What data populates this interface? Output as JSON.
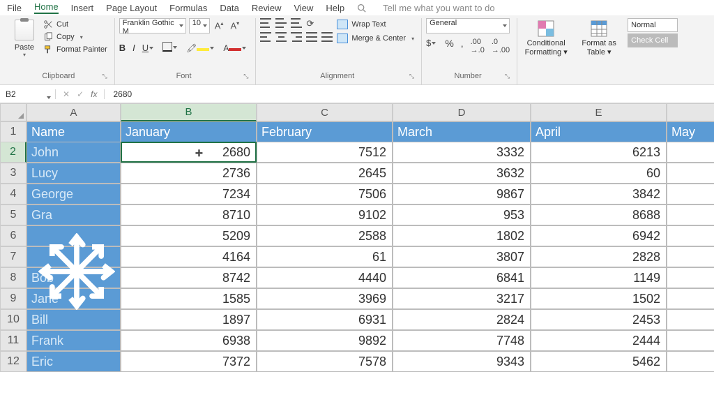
{
  "menu": {
    "file": "File",
    "home": "Home",
    "insert": "Insert",
    "page": "Page Layout",
    "formulas": "Formulas",
    "data": "Data",
    "review": "Review",
    "view": "View",
    "help": "Help",
    "tell": "Tell me what you want to do"
  },
  "ribbon": {
    "paste": "Paste",
    "cut": "Cut",
    "copy": "Copy",
    "fp": "Format Painter",
    "clipboard": "Clipboard",
    "fontname": "Franklin Gothic M",
    "fontsize": "10",
    "font": "Font",
    "wrap": "Wrap Text",
    "merge": "Merge & Center",
    "alignment": "Alignment",
    "numfmt": "General",
    "number": "Number",
    "cond": "Conditional",
    "cond2": "Formatting",
    "fat": "Format as",
    "fat2": "Table",
    "normal": "Normal",
    "check": "Check Cell"
  },
  "formulabar": {
    "cellref": "B2",
    "value": "2680"
  },
  "columns": [
    "A",
    "B",
    "C",
    "D",
    "E"
  ],
  "headers": {
    "name": "Name",
    "jan": "January",
    "feb": "February",
    "mar": "March",
    "apr": "April",
    "may": "May"
  },
  "chart_data": {
    "type": "table",
    "columns": [
      "Name",
      "January",
      "February",
      "March",
      "April"
    ],
    "rows": [
      {
        "name": "John",
        "jan": 2680,
        "feb": 7512,
        "mar": 3332,
        "apr": 6213
      },
      {
        "name": "Lucy",
        "jan": 2736,
        "feb": 2645,
        "mar": 3632,
        "apr": 60
      },
      {
        "name": "George",
        "jan": 7234,
        "feb": 7506,
        "mar": 9867,
        "apr": 3842
      },
      {
        "name": "Gra",
        "jan": 8710,
        "feb": 9102,
        "mar": 953,
        "apr": 8688
      },
      {
        "name": "",
        "jan": 5209,
        "feb": 2588,
        "mar": 1802,
        "apr": 6942
      },
      {
        "name": "",
        "jan": 4164,
        "feb": 61,
        "mar": 3807,
        "apr": 2828
      },
      {
        "name": "Bob",
        "jan": 8742,
        "feb": 4440,
        "mar": 6841,
        "apr": 1149
      },
      {
        "name": "Jane",
        "jan": 1585,
        "feb": 3969,
        "mar": 3217,
        "apr": 1502
      },
      {
        "name": "Bill",
        "jan": 1897,
        "feb": 6931,
        "mar": 2824,
        "apr": 2453
      },
      {
        "name": "Frank",
        "jan": 6938,
        "feb": 9892,
        "mar": 7748,
        "apr": 2444
      },
      {
        "name": "Eric",
        "jan": 7372,
        "feb": 7578,
        "mar": 9343,
        "apr": 5462
      }
    ]
  }
}
